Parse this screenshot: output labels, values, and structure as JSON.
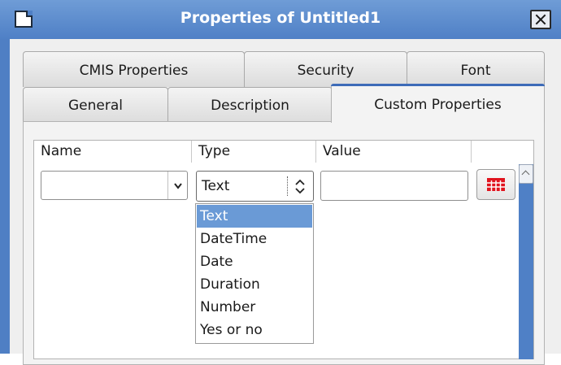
{
  "window": {
    "title": "Properties of Untitled1"
  },
  "tabs_row1": [
    "CMIS Properties",
    "Security",
    "Font"
  ],
  "tabs_row2": [
    "General",
    "Description",
    "Custom Properties"
  ],
  "active_tab": "Custom Properties",
  "columns": [
    "Name",
    "Type",
    "Value"
  ],
  "row": {
    "name_value": "",
    "type_value": "Text",
    "value_value": ""
  },
  "type_options": [
    "Text",
    "DateTime",
    "Date",
    "Duration",
    "Number",
    "Yes or no"
  ],
  "selected_type": "Text",
  "colors": {
    "titlebar": "#4f80c6",
    "selection": "#6a9ad6",
    "calendar_icon": "#e0141e"
  },
  "icons": [
    "document-icon",
    "close-icon",
    "chevron-down-icon",
    "spin-updown-icon",
    "calendar-icon",
    "scroll-up-icon"
  ]
}
